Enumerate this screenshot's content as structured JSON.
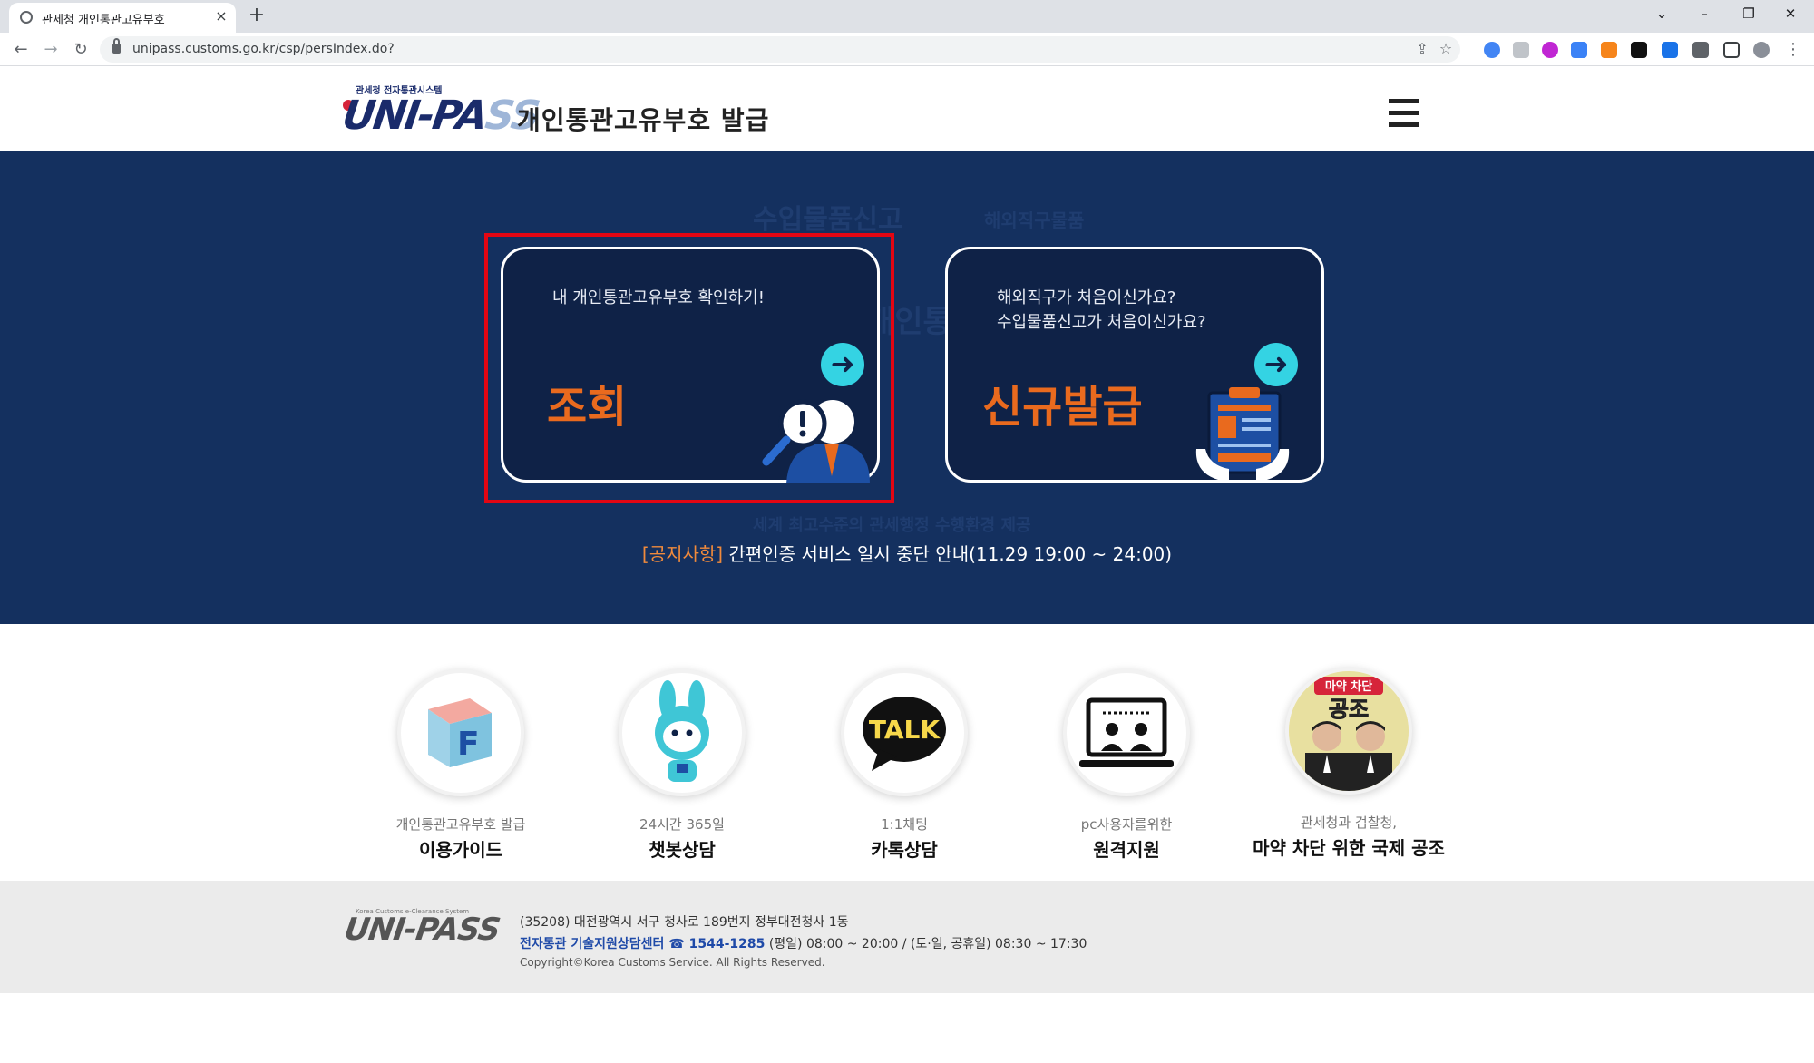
{
  "browser": {
    "tab_title": "관세청 개인통관고유부호",
    "tab_close": "×",
    "new_tab": "+",
    "url": "unipass.customs.go.kr/csp/persIndex.do?",
    "win_min": "–",
    "win_max": "❐",
    "win_close": "✕",
    "win_dropdown": "⌄"
  },
  "header": {
    "logo_small": "관세청 전자통관시스템",
    "logo_uni": "UNI-PA",
    "logo_ss": "SS",
    "title": "개인통관고유부호 발급"
  },
  "hero": {
    "watermarks": [
      "수입물품신고",
      "해외직구물품",
      "개인통관",
      "세계 최고수준의 관세행정 수행환경 제공"
    ],
    "card_lookup": {
      "sub": "내 개인통관고유부호 확인하기!",
      "main": "조회",
      "arrow": "➜"
    },
    "card_new": {
      "sub": "해외직구가 처음이신가요?\n수입물품신고가 처음이신가요?",
      "main": "신규발급",
      "arrow": "➜"
    },
    "notice_tag": "[공지사항]",
    "notice_text": " 간편인증 서비스 일시 중단 안내(11.29 19:00 ~ 24:00)"
  },
  "quick_menu": [
    {
      "sub": "개인통관고유부호 발급",
      "main": "이용가이드",
      "icon": "guide-cube-icon",
      "glyph": "F"
    },
    {
      "sub": "24시간 365일",
      "main": "챗봇상담",
      "icon": "chatbot-rabbit-icon",
      "glyph": ""
    },
    {
      "sub": "1:1채팅",
      "main": "카톡상담",
      "icon": "kakaotalk-icon",
      "glyph": "TALK"
    },
    {
      "sub": "pc사용자를위한",
      "main": "원격지원",
      "icon": "remote-monitor-icon",
      "glyph": ""
    },
    {
      "sub": "관세청과 검찰청,",
      "main": "마약 차단 위한 국제 공조",
      "icon": "campaign-photo-icon",
      "glyph": "공조",
      "badge": "마약 차단"
    }
  ],
  "footer": {
    "logo": "UNI-PASS",
    "logo_small": "Korea Customs e-Clearance System",
    "address": "(35208) 대전광역시 서구 청사로 189번지 정부대전청사 1동",
    "center_label": "전자통관 기술지원상담센터 ☎ 1544-1285",
    "center_hours": " (평일) 08:00 ~ 20:00 / (토·일, 공휴일) 08:30 ~ 17:30",
    "copyright": "Copyright©Korea Customs Service. All Rights Reserved."
  },
  "colors": {
    "hero_bg": "#14305f",
    "accent_orange": "#e96a1e",
    "arrow_cyan": "#34d3e3",
    "highlight_red": "#e30613"
  }
}
